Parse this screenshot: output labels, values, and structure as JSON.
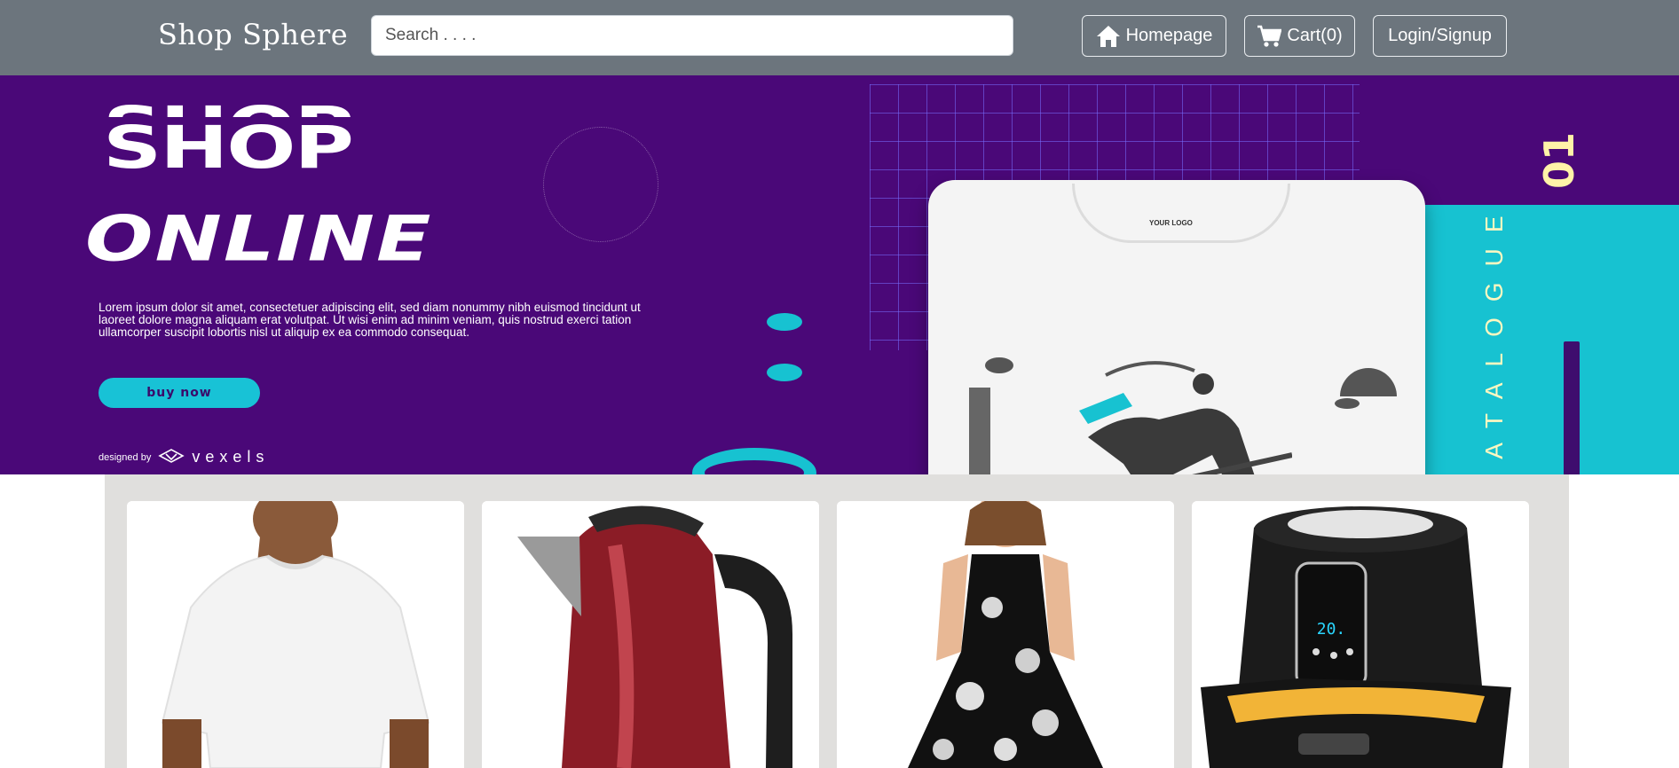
{
  "navbar": {
    "brand": "Shop Sphere",
    "search_placeholder": "Search . . . .",
    "home_label": "Homepage",
    "cart_label": "Cart(0)",
    "login_label": "Login/Signup",
    "home_icon": "home-icon",
    "cart_icon": "cart-icon"
  },
  "hero": {
    "title_line1": "SHOP",
    "title_line2": "ONLINE",
    "body": "Lorem ipsum dolor sit amet, consectetuer adipiscing elit, sed diam nonummy nibh euismod tincidunt ut laoreet dolore magna aliquam erat volutpat. Ut wisi enim ad minim veniam, quis nostrud exerci tation ullamcorper suscipit lobortis nisl ut aliquip ex ea commodo consequat.",
    "button": "buy now",
    "designed_by": "designed by",
    "vexels": "vexels",
    "catalogue": "CATALOGUE",
    "catalogue_number": "01",
    "tshirt_logo": "YOUR LOGO",
    "colors": {
      "background": "#4a0878",
      "accent": "#17c2d1",
      "catalogue": "#fff7c0"
    }
  },
  "products": [
    {
      "image": "white-tshirt"
    },
    {
      "image": "red-kettle"
    },
    {
      "image": "floral-dress"
    },
    {
      "image": "black-air-fryer"
    }
  ]
}
